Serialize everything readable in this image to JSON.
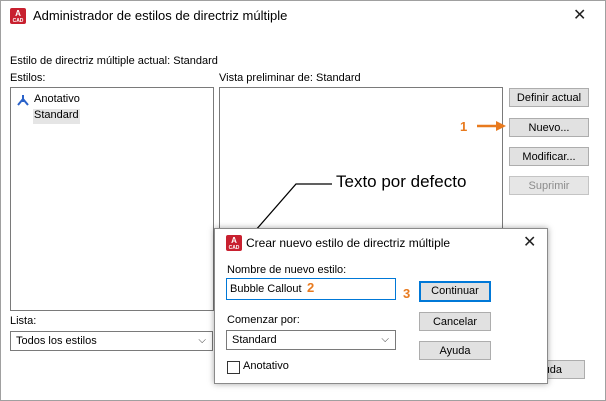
{
  "main": {
    "title": "Administrador de estilos de directriz múltiple",
    "current_style": "Estilo de directriz múltiple actual: Standard",
    "styles_label": "Estilos:",
    "preview_label": "Vista preliminar de: Standard",
    "styles": [
      "Anotativo",
      "Standard"
    ],
    "list_label": "Lista:",
    "list_value": "Todos los estilos",
    "buttons": {
      "set_current": "Definir actual",
      "new": "Nuevo...",
      "modify": "Modificar...",
      "delete": "Suprimir",
      "help_partial": "uda"
    }
  },
  "annotation": {
    "step1": "1",
    "step2": "2",
    "step3": "3",
    "callout": "Texto por defecto"
  },
  "dialog": {
    "title": "Crear nuevo estilo de directriz múltiple",
    "name_label": "Nombre de nuevo estilo:",
    "name_value": "Bubble Callout",
    "start_label": "Comenzar por:",
    "start_value": "Standard",
    "annotative_label": "Anotativo",
    "buttons": {
      "continue": "Continuar",
      "cancel": "Cancelar",
      "help": "Ayuda"
    }
  },
  "colors": {
    "accent_orange": "#e87a1e",
    "app_icon_red": "#c8202f",
    "focus_blue": "#0078d7",
    "style_icon_blue": "#2a62c9"
  },
  "icons": {
    "app": "autocad-a-icon",
    "close": "close-icon",
    "annotative": "annotative-scale-icon",
    "chevron": "chevron-down-icon"
  }
}
